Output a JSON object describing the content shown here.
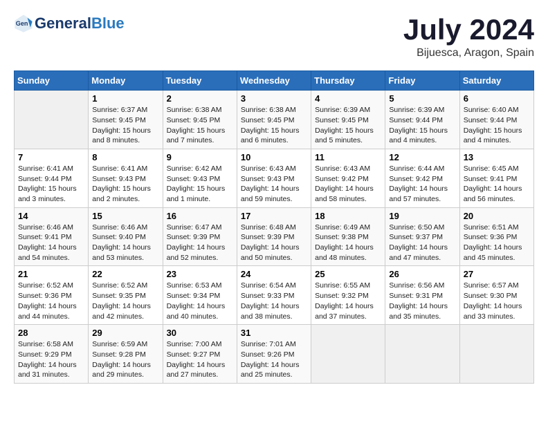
{
  "header": {
    "logo_general": "General",
    "logo_blue": "Blue",
    "month_title": "July 2024",
    "location": "Bijuesca, Aragon, Spain"
  },
  "weekdays": [
    "Sunday",
    "Monday",
    "Tuesday",
    "Wednesday",
    "Thursday",
    "Friday",
    "Saturday"
  ],
  "weeks": [
    [
      {
        "date": "",
        "sunrise": "",
        "sunset": "",
        "daylight": ""
      },
      {
        "date": "1",
        "sunrise": "Sunrise: 6:37 AM",
        "sunset": "Sunset: 9:45 PM",
        "daylight": "Daylight: 15 hours and 8 minutes."
      },
      {
        "date": "2",
        "sunrise": "Sunrise: 6:38 AM",
        "sunset": "Sunset: 9:45 PM",
        "daylight": "Daylight: 15 hours and 7 minutes."
      },
      {
        "date": "3",
        "sunrise": "Sunrise: 6:38 AM",
        "sunset": "Sunset: 9:45 PM",
        "daylight": "Daylight: 15 hours and 6 minutes."
      },
      {
        "date": "4",
        "sunrise": "Sunrise: 6:39 AM",
        "sunset": "Sunset: 9:45 PM",
        "daylight": "Daylight: 15 hours and 5 minutes."
      },
      {
        "date": "5",
        "sunrise": "Sunrise: 6:39 AM",
        "sunset": "Sunset: 9:44 PM",
        "daylight": "Daylight: 15 hours and 4 minutes."
      },
      {
        "date": "6",
        "sunrise": "Sunrise: 6:40 AM",
        "sunset": "Sunset: 9:44 PM",
        "daylight": "Daylight: 15 hours and 4 minutes."
      }
    ],
    [
      {
        "date": "7",
        "sunrise": "Sunrise: 6:41 AM",
        "sunset": "Sunset: 9:44 PM",
        "daylight": "Daylight: 15 hours and 3 minutes."
      },
      {
        "date": "8",
        "sunrise": "Sunrise: 6:41 AM",
        "sunset": "Sunset: 9:43 PM",
        "daylight": "Daylight: 15 hours and 2 minutes."
      },
      {
        "date": "9",
        "sunrise": "Sunrise: 6:42 AM",
        "sunset": "Sunset: 9:43 PM",
        "daylight": "Daylight: 15 hours and 1 minute."
      },
      {
        "date": "10",
        "sunrise": "Sunrise: 6:43 AM",
        "sunset": "Sunset: 9:43 PM",
        "daylight": "Daylight: 14 hours and 59 minutes."
      },
      {
        "date": "11",
        "sunrise": "Sunrise: 6:43 AM",
        "sunset": "Sunset: 9:42 PM",
        "daylight": "Daylight: 14 hours and 58 minutes."
      },
      {
        "date": "12",
        "sunrise": "Sunrise: 6:44 AM",
        "sunset": "Sunset: 9:42 PM",
        "daylight": "Daylight: 14 hours and 57 minutes."
      },
      {
        "date": "13",
        "sunrise": "Sunrise: 6:45 AM",
        "sunset": "Sunset: 9:41 PM",
        "daylight": "Daylight: 14 hours and 56 minutes."
      }
    ],
    [
      {
        "date": "14",
        "sunrise": "Sunrise: 6:46 AM",
        "sunset": "Sunset: 9:41 PM",
        "daylight": "Daylight: 14 hours and 54 minutes."
      },
      {
        "date": "15",
        "sunrise": "Sunrise: 6:46 AM",
        "sunset": "Sunset: 9:40 PM",
        "daylight": "Daylight: 14 hours and 53 minutes."
      },
      {
        "date": "16",
        "sunrise": "Sunrise: 6:47 AM",
        "sunset": "Sunset: 9:39 PM",
        "daylight": "Daylight: 14 hours and 52 minutes."
      },
      {
        "date": "17",
        "sunrise": "Sunrise: 6:48 AM",
        "sunset": "Sunset: 9:39 PM",
        "daylight": "Daylight: 14 hours and 50 minutes."
      },
      {
        "date": "18",
        "sunrise": "Sunrise: 6:49 AM",
        "sunset": "Sunset: 9:38 PM",
        "daylight": "Daylight: 14 hours and 48 minutes."
      },
      {
        "date": "19",
        "sunrise": "Sunrise: 6:50 AM",
        "sunset": "Sunset: 9:37 PM",
        "daylight": "Daylight: 14 hours and 47 minutes."
      },
      {
        "date": "20",
        "sunrise": "Sunrise: 6:51 AM",
        "sunset": "Sunset: 9:36 PM",
        "daylight": "Daylight: 14 hours and 45 minutes."
      }
    ],
    [
      {
        "date": "21",
        "sunrise": "Sunrise: 6:52 AM",
        "sunset": "Sunset: 9:36 PM",
        "daylight": "Daylight: 14 hours and 44 minutes."
      },
      {
        "date": "22",
        "sunrise": "Sunrise: 6:52 AM",
        "sunset": "Sunset: 9:35 PM",
        "daylight": "Daylight: 14 hours and 42 minutes."
      },
      {
        "date": "23",
        "sunrise": "Sunrise: 6:53 AM",
        "sunset": "Sunset: 9:34 PM",
        "daylight": "Daylight: 14 hours and 40 minutes."
      },
      {
        "date": "24",
        "sunrise": "Sunrise: 6:54 AM",
        "sunset": "Sunset: 9:33 PM",
        "daylight": "Daylight: 14 hours and 38 minutes."
      },
      {
        "date": "25",
        "sunrise": "Sunrise: 6:55 AM",
        "sunset": "Sunset: 9:32 PM",
        "daylight": "Daylight: 14 hours and 37 minutes."
      },
      {
        "date": "26",
        "sunrise": "Sunrise: 6:56 AM",
        "sunset": "Sunset: 9:31 PM",
        "daylight": "Daylight: 14 hours and 35 minutes."
      },
      {
        "date": "27",
        "sunrise": "Sunrise: 6:57 AM",
        "sunset": "Sunset: 9:30 PM",
        "daylight": "Daylight: 14 hours and 33 minutes."
      }
    ],
    [
      {
        "date": "28",
        "sunrise": "Sunrise: 6:58 AM",
        "sunset": "Sunset: 9:29 PM",
        "daylight": "Daylight: 14 hours and 31 minutes."
      },
      {
        "date": "29",
        "sunrise": "Sunrise: 6:59 AM",
        "sunset": "Sunset: 9:28 PM",
        "daylight": "Daylight: 14 hours and 29 minutes."
      },
      {
        "date": "30",
        "sunrise": "Sunrise: 7:00 AM",
        "sunset": "Sunset: 9:27 PM",
        "daylight": "Daylight: 14 hours and 27 minutes."
      },
      {
        "date": "31",
        "sunrise": "Sunrise: 7:01 AM",
        "sunset": "Sunset: 9:26 PM",
        "daylight": "Daylight: 14 hours and 25 minutes."
      },
      {
        "date": "",
        "sunrise": "",
        "sunset": "",
        "daylight": ""
      },
      {
        "date": "",
        "sunrise": "",
        "sunset": "",
        "daylight": ""
      },
      {
        "date": "",
        "sunrise": "",
        "sunset": "",
        "daylight": ""
      }
    ]
  ]
}
